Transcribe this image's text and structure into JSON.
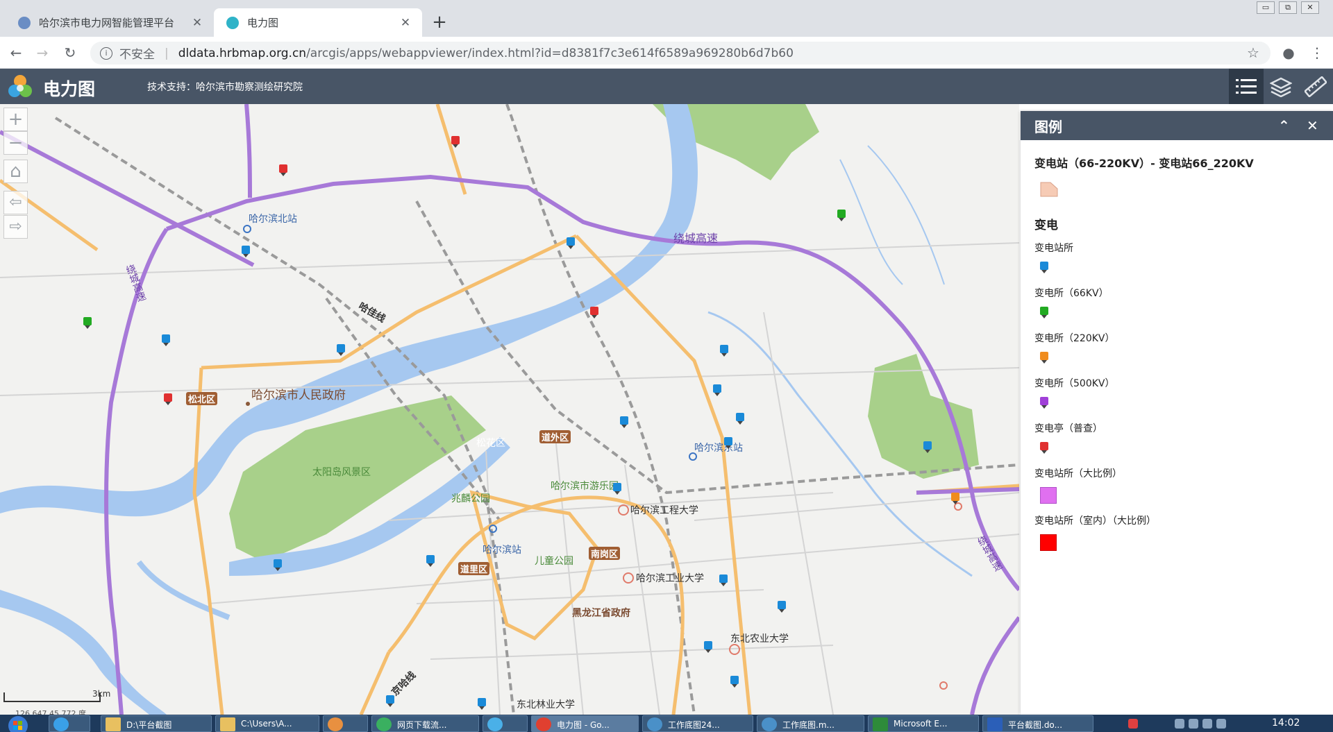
{
  "browser": {
    "tabs": [
      {
        "title": "哈尔滨市电力网智能管理平台",
        "active": false
      },
      {
        "title": "电力图",
        "active": true
      }
    ],
    "new_tab_label": "+",
    "address": {
      "security": "不安全",
      "separator": "|",
      "host": "dldata.hrbmap.org.cn",
      "path": "/arcgis/apps/webappviewer/index.html?id=d8381f7c3e614f6589a969280b6d7b60"
    },
    "icons": {
      "back": "back-arrow-icon",
      "forward": "forward-arrow-icon",
      "reload": "reload-icon",
      "star": "star-icon",
      "account": "account-icon",
      "menu": "kebab-menu-icon"
    },
    "window_buttons": [
      "▭",
      "⧉",
      "✕"
    ]
  },
  "app": {
    "title": "电力图",
    "support": "技术支持：哈尔滨市勘察测绘研究院",
    "accent": "#485566",
    "tools": [
      "legend-list-icon",
      "layers-icon",
      "measure-ruler-icon"
    ]
  },
  "map": {
    "zoom_in": "+",
    "zoom_out": "−",
    "nav_prev": "⇦",
    "nav_next": "⇨",
    "scale": "3km",
    "coords": "126.647 45.772 度",
    "labels": {
      "north_station": "哈尔滨北站",
      "ring_expressway": "绕城高速",
      "ring_expressway_v": "绕城高速",
      "ring_expressway_se": "绕城高速",
      "hajia_line": "哈佳线",
      "gov": "哈尔滨市人民政府",
      "songbei": "松北区",
      "sun_island": "太阳岛风景区",
      "songhua_district": "松花区",
      "daowai": "道外区",
      "east_station": "哈尔滨东站",
      "amusement": "哈尔滨市游乐园",
      "zhaolin": "兆麟公园",
      "heu": "哈尔滨工程大学",
      "main_station": "哈尔滨站",
      "childrens_park": "儿童公园",
      "nangang": "南岗区",
      "daoli": "道里区",
      "hit": "哈尔滨工业大学",
      "province_gov": "黑龙江省政府",
      "neau": "东北农业大学",
      "nefu": "东北林业大学",
      "jingha_line": "京哈线"
    },
    "colors": {
      "water": "#a6c8f0",
      "park": "#a8d08a",
      "expressway": "#a779d8",
      "arterial": "#f5be6e",
      "rail": "#9a9a9a"
    },
    "markers": [
      {
        "type": "substation",
        "color": "#1a8ad8"
      },
      {
        "type": "66kv",
        "color": "#22aa22"
      },
      {
        "type": "220kv",
        "color": "#f08c1e"
      },
      {
        "type": "500kv",
        "color": "#a040d8"
      },
      {
        "type": "pavilion",
        "color": "#e03030"
      }
    ]
  },
  "legend": {
    "title": "图例",
    "collapse_icon": "collapse-up-icon",
    "close_icon": "close-icon",
    "section1": "变电站（66-220KV）- 变电站66_220KV",
    "section2": "变电",
    "items": [
      {
        "label": "变电站所",
        "color": "#1a8ad8",
        "shape": "pin"
      },
      {
        "label": "变电所（66KV）",
        "color": "#22aa22",
        "shape": "pin"
      },
      {
        "label": "变电所（220KV）",
        "color": "#f08c1e",
        "shape": "pin"
      },
      {
        "label": "变电所（500KV）",
        "color": "#a040d8",
        "shape": "pin"
      },
      {
        "label": "变电亭（普查）",
        "color": "#e03030",
        "shape": "pin"
      },
      {
        "label": "变电站所（大比例）",
        "color": "#e070f0",
        "shape": "square"
      },
      {
        "label": "变电站所（室内）（大比例）",
        "color": "#ff0000",
        "shape": "square"
      }
    ]
  },
  "taskbar": {
    "items": [
      "D:\\平台截图",
      "C:\\Users\\A...",
      "",
      "网页下载流...",
      "",
      "电力图 - Go...",
      "工作底图24...",
      "工作底图.m...",
      "Microsoft E...",
      "平台截图.do..."
    ],
    "clock": "14:02"
  }
}
